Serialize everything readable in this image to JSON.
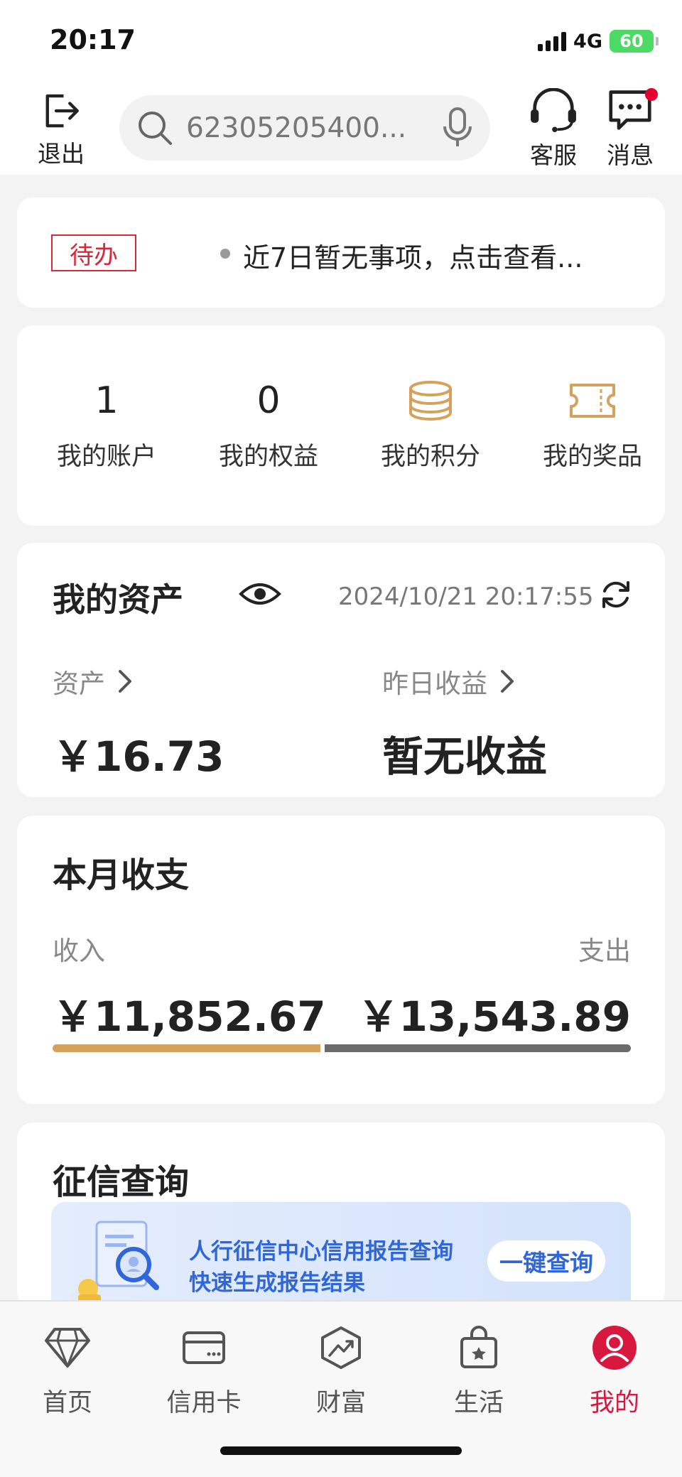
{
  "status_bar": {
    "time": "20:17",
    "network": "4G",
    "battery": "60"
  },
  "header": {
    "exit_label": "退出",
    "search_text": "62305205400...",
    "service_label": "客服",
    "message_label": "消息"
  },
  "todo": {
    "tag": "待办",
    "text": "近7日暂无事项，点击查看..."
  },
  "quick": {
    "items": [
      {
        "value": "1",
        "label": "我的账户"
      },
      {
        "value": "0",
        "label": "我的权益"
      },
      {
        "value": "",
        "label": "我的积分",
        "icon": "coins-icon"
      },
      {
        "value": "",
        "label": "我的奖品",
        "icon": "ticket-icon"
      }
    ]
  },
  "assets": {
    "title": "我的资产",
    "timestamp": "2024/10/21 20:17:55",
    "asset_label": "资产",
    "asset_value": "￥16.73",
    "yield_label": "昨日收益",
    "yield_value": "暂无收益"
  },
  "monthly": {
    "title": "本月收支",
    "income_label": "收入",
    "income_value": "￥11,852.67",
    "expense_label": "支出",
    "expense_value": "￥13,543.89",
    "income_share": 0.4667
  },
  "credit": {
    "title": "征信查询",
    "banner_line1": "人行征信中心信用报告查询",
    "banner_line2": "快速生成报告结果",
    "button": "一键查询"
  },
  "tabbar": {
    "tabs": [
      {
        "label": "首页",
        "icon": "diamond-icon"
      },
      {
        "label": "信用卡",
        "icon": "card-icon"
      },
      {
        "label": "财富",
        "icon": "wealth-icon"
      },
      {
        "label": "生活",
        "icon": "bag-icon"
      },
      {
        "label": "我的",
        "icon": "user-icon",
        "active": true
      }
    ]
  },
  "colors": {
    "accent_red": "#d8183e",
    "gold": "#d4a25d",
    "banner_blue": "#2f66d9"
  }
}
